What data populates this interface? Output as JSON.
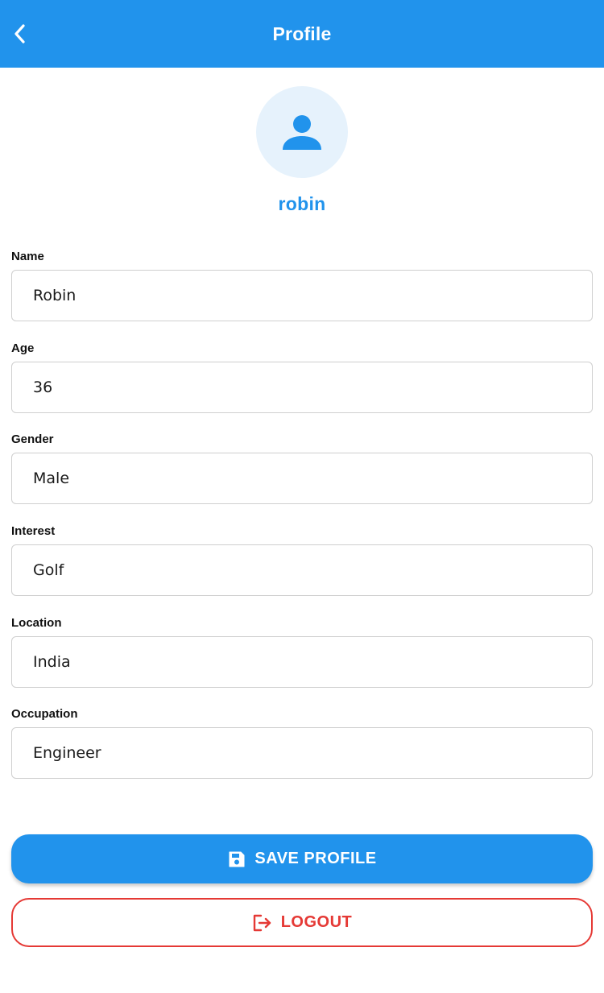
{
  "app_bar": {
    "title": "Profile",
    "back_icon": "chevron-left-icon",
    "color": "#2193EC"
  },
  "profile": {
    "avatar_icon": "person-icon",
    "username": "robin"
  },
  "fields": [
    {
      "label": "Name",
      "value": "Robin"
    },
    {
      "label": "Age",
      "value": "36"
    },
    {
      "label": "Gender",
      "value": "Male"
    },
    {
      "label": "Interest",
      "value": "Golf"
    },
    {
      "label": "Location",
      "value": "India"
    },
    {
      "label": "Occupation",
      "value": "Engineer"
    }
  ],
  "actions": {
    "save_label": "SAVE PROFILE",
    "save_icon": "save-icon",
    "logout_label": "LOGOUT",
    "logout_icon": "logout-icon",
    "logout_color": "#E53935"
  }
}
